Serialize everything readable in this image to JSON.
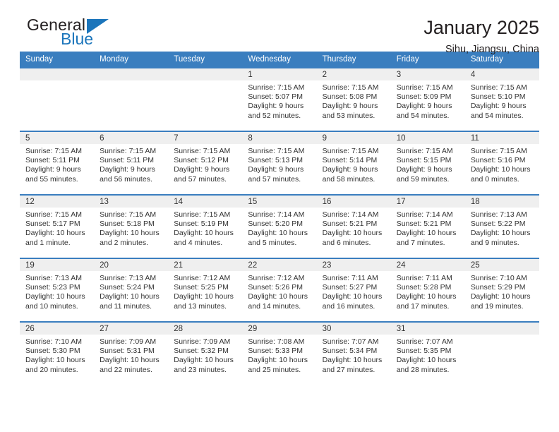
{
  "brand": {
    "name_part1": "General",
    "name_part2": "Blue",
    "logo_icon": "triangle-icon"
  },
  "header": {
    "title": "January 2025",
    "subtitle": "Sihu, Jiangsu, China"
  },
  "colors": {
    "header_blue": "#3a7ebf",
    "brand_blue": "#1b75bb",
    "daynum_band": "#efefef",
    "text": "#333333"
  },
  "weekday_headers": [
    "Sunday",
    "Monday",
    "Tuesday",
    "Wednesday",
    "Thursday",
    "Friday",
    "Saturday"
  ],
  "weeks": [
    [
      {
        "day": "",
        "sunrise": "",
        "sunset": "",
        "daylight": ""
      },
      {
        "day": "",
        "sunrise": "",
        "sunset": "",
        "daylight": ""
      },
      {
        "day": "",
        "sunrise": "",
        "sunset": "",
        "daylight": ""
      },
      {
        "day": "1",
        "sunrise": "Sunrise: 7:15 AM",
        "sunset": "Sunset: 5:07 PM",
        "daylight": "Daylight: 9 hours and 52 minutes."
      },
      {
        "day": "2",
        "sunrise": "Sunrise: 7:15 AM",
        "sunset": "Sunset: 5:08 PM",
        "daylight": "Daylight: 9 hours and 53 minutes."
      },
      {
        "day": "3",
        "sunrise": "Sunrise: 7:15 AM",
        "sunset": "Sunset: 5:09 PM",
        "daylight": "Daylight: 9 hours and 54 minutes."
      },
      {
        "day": "4",
        "sunrise": "Sunrise: 7:15 AM",
        "sunset": "Sunset: 5:10 PM",
        "daylight": "Daylight: 9 hours and 54 minutes."
      }
    ],
    [
      {
        "day": "5",
        "sunrise": "Sunrise: 7:15 AM",
        "sunset": "Sunset: 5:11 PM",
        "daylight": "Daylight: 9 hours and 55 minutes."
      },
      {
        "day": "6",
        "sunrise": "Sunrise: 7:15 AM",
        "sunset": "Sunset: 5:11 PM",
        "daylight": "Daylight: 9 hours and 56 minutes."
      },
      {
        "day": "7",
        "sunrise": "Sunrise: 7:15 AM",
        "sunset": "Sunset: 5:12 PM",
        "daylight": "Daylight: 9 hours and 57 minutes."
      },
      {
        "day": "8",
        "sunrise": "Sunrise: 7:15 AM",
        "sunset": "Sunset: 5:13 PM",
        "daylight": "Daylight: 9 hours and 57 minutes."
      },
      {
        "day": "9",
        "sunrise": "Sunrise: 7:15 AM",
        "sunset": "Sunset: 5:14 PM",
        "daylight": "Daylight: 9 hours and 58 minutes."
      },
      {
        "day": "10",
        "sunrise": "Sunrise: 7:15 AM",
        "sunset": "Sunset: 5:15 PM",
        "daylight": "Daylight: 9 hours and 59 minutes."
      },
      {
        "day": "11",
        "sunrise": "Sunrise: 7:15 AM",
        "sunset": "Sunset: 5:16 PM",
        "daylight": "Daylight: 10 hours and 0 minutes."
      }
    ],
    [
      {
        "day": "12",
        "sunrise": "Sunrise: 7:15 AM",
        "sunset": "Sunset: 5:17 PM",
        "daylight": "Daylight: 10 hours and 1 minute."
      },
      {
        "day": "13",
        "sunrise": "Sunrise: 7:15 AM",
        "sunset": "Sunset: 5:18 PM",
        "daylight": "Daylight: 10 hours and 2 minutes."
      },
      {
        "day": "14",
        "sunrise": "Sunrise: 7:15 AM",
        "sunset": "Sunset: 5:19 PM",
        "daylight": "Daylight: 10 hours and 4 minutes."
      },
      {
        "day": "15",
        "sunrise": "Sunrise: 7:14 AM",
        "sunset": "Sunset: 5:20 PM",
        "daylight": "Daylight: 10 hours and 5 minutes."
      },
      {
        "day": "16",
        "sunrise": "Sunrise: 7:14 AM",
        "sunset": "Sunset: 5:21 PM",
        "daylight": "Daylight: 10 hours and 6 minutes."
      },
      {
        "day": "17",
        "sunrise": "Sunrise: 7:14 AM",
        "sunset": "Sunset: 5:21 PM",
        "daylight": "Daylight: 10 hours and 7 minutes."
      },
      {
        "day": "18",
        "sunrise": "Sunrise: 7:13 AM",
        "sunset": "Sunset: 5:22 PM",
        "daylight": "Daylight: 10 hours and 9 minutes."
      }
    ],
    [
      {
        "day": "19",
        "sunrise": "Sunrise: 7:13 AM",
        "sunset": "Sunset: 5:23 PM",
        "daylight": "Daylight: 10 hours and 10 minutes."
      },
      {
        "day": "20",
        "sunrise": "Sunrise: 7:13 AM",
        "sunset": "Sunset: 5:24 PM",
        "daylight": "Daylight: 10 hours and 11 minutes."
      },
      {
        "day": "21",
        "sunrise": "Sunrise: 7:12 AM",
        "sunset": "Sunset: 5:25 PM",
        "daylight": "Daylight: 10 hours and 13 minutes."
      },
      {
        "day": "22",
        "sunrise": "Sunrise: 7:12 AM",
        "sunset": "Sunset: 5:26 PM",
        "daylight": "Daylight: 10 hours and 14 minutes."
      },
      {
        "day": "23",
        "sunrise": "Sunrise: 7:11 AM",
        "sunset": "Sunset: 5:27 PM",
        "daylight": "Daylight: 10 hours and 16 minutes."
      },
      {
        "day": "24",
        "sunrise": "Sunrise: 7:11 AM",
        "sunset": "Sunset: 5:28 PM",
        "daylight": "Daylight: 10 hours and 17 minutes."
      },
      {
        "day": "25",
        "sunrise": "Sunrise: 7:10 AM",
        "sunset": "Sunset: 5:29 PM",
        "daylight": "Daylight: 10 hours and 19 minutes."
      }
    ],
    [
      {
        "day": "26",
        "sunrise": "Sunrise: 7:10 AM",
        "sunset": "Sunset: 5:30 PM",
        "daylight": "Daylight: 10 hours and 20 minutes."
      },
      {
        "day": "27",
        "sunrise": "Sunrise: 7:09 AM",
        "sunset": "Sunset: 5:31 PM",
        "daylight": "Daylight: 10 hours and 22 minutes."
      },
      {
        "day": "28",
        "sunrise": "Sunrise: 7:09 AM",
        "sunset": "Sunset: 5:32 PM",
        "daylight": "Daylight: 10 hours and 23 minutes."
      },
      {
        "day": "29",
        "sunrise": "Sunrise: 7:08 AM",
        "sunset": "Sunset: 5:33 PM",
        "daylight": "Daylight: 10 hours and 25 minutes."
      },
      {
        "day": "30",
        "sunrise": "Sunrise: 7:07 AM",
        "sunset": "Sunset: 5:34 PM",
        "daylight": "Daylight: 10 hours and 27 minutes."
      },
      {
        "day": "31",
        "sunrise": "Sunrise: 7:07 AM",
        "sunset": "Sunset: 5:35 PM",
        "daylight": "Daylight: 10 hours and 28 minutes."
      },
      {
        "day": "",
        "sunrise": "",
        "sunset": "",
        "daylight": ""
      }
    ]
  ]
}
